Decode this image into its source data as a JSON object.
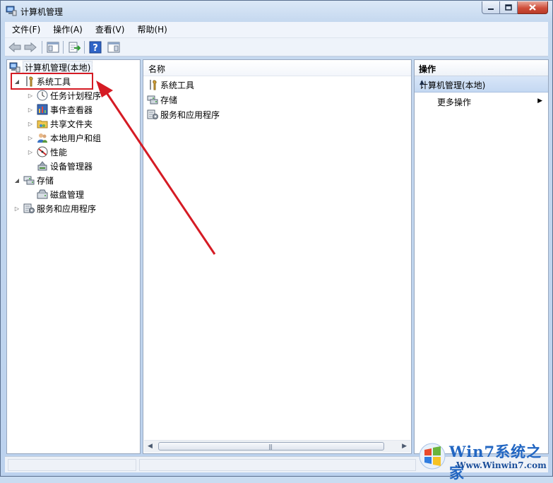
{
  "window": {
    "title": "计算机管理"
  },
  "menu": [
    {
      "label": "文件(F)"
    },
    {
      "label": "操作(A)"
    },
    {
      "label": "查看(V)"
    },
    {
      "label": "帮助(H)"
    }
  ],
  "toolbar": {
    "icons": [
      "back-icon",
      "forward-icon",
      "show-hide-tree-icon",
      "export-list-icon",
      "help-icon",
      "show-hide-action-pane-icon"
    ]
  },
  "tree": {
    "root": "计算机管理(本地)",
    "nodes": [
      {
        "label": "系统工具",
        "icon": "tools-icon",
        "expanded": true
      },
      {
        "label": "任务计划程序",
        "icon": "clock-icon"
      },
      {
        "label": "事件查看器",
        "icon": "event-viewer-icon"
      },
      {
        "label": "共享文件夹",
        "icon": "shared-folder-icon"
      },
      {
        "label": "本地用户和组",
        "icon": "users-icon"
      },
      {
        "label": "性能",
        "icon": "performance-icon"
      },
      {
        "label": "设备管理器",
        "icon": "device-manager-icon"
      },
      {
        "label": "存储",
        "icon": "storage-icon",
        "expanded": true
      },
      {
        "label": "磁盘管理",
        "icon": "disk-icon"
      },
      {
        "label": "服务和应用程序",
        "icon": "services-icon"
      }
    ]
  },
  "list": {
    "header": "名称",
    "rows": [
      {
        "label": "系统工具",
        "icon": "tools-icon"
      },
      {
        "label": "存储",
        "icon": "storage-icon"
      },
      {
        "label": "服务和应用程序",
        "icon": "services-icon"
      }
    ]
  },
  "actions": {
    "header": "操作",
    "section": "计算机管理(本地)",
    "item": "更多操作"
  },
  "watermark": {
    "title": "Win7系统之家",
    "url": "Www.Winwin7.com"
  },
  "colors": {
    "highlight": "#d51b24",
    "accent": "#2266c2"
  }
}
